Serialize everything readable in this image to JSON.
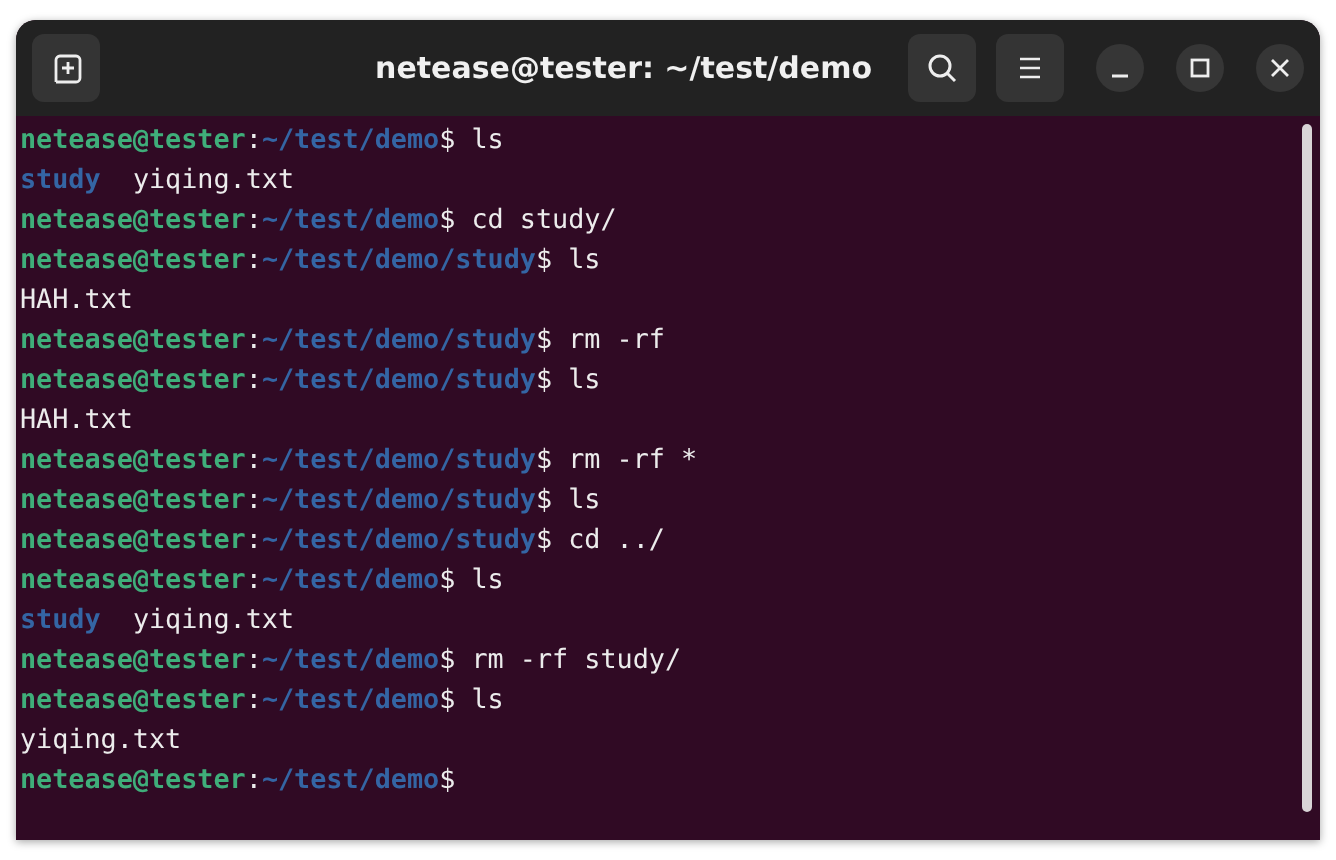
{
  "window": {
    "title": "netease@tester: ~/test/demo"
  },
  "terminal": {
    "lines": [
      {
        "kind": "prompt",
        "user": "netease@tester",
        "separator": ":",
        "path": "~/test/demo",
        "symbol": "$",
        "command": " ls"
      },
      {
        "kind": "output",
        "entries": [
          {
            "kind": "dir",
            "name": "study"
          },
          {
            "kind": "file",
            "name": "yiqing.txt"
          }
        ]
      },
      {
        "kind": "prompt",
        "user": "netease@tester",
        "separator": ":",
        "path": "~/test/demo",
        "symbol": "$",
        "command": " cd study/"
      },
      {
        "kind": "prompt",
        "user": "netease@tester",
        "separator": ":",
        "path": "~/test/demo/study",
        "symbol": "$",
        "command": " ls"
      },
      {
        "kind": "output",
        "entries": [
          {
            "kind": "file",
            "name": "HAH.txt"
          }
        ]
      },
      {
        "kind": "prompt",
        "user": "netease@tester",
        "separator": ":",
        "path": "~/test/demo/study",
        "symbol": "$",
        "command": " rm -rf"
      },
      {
        "kind": "prompt",
        "user": "netease@tester",
        "separator": ":",
        "path": "~/test/demo/study",
        "symbol": "$",
        "command": " ls"
      },
      {
        "kind": "output",
        "entries": [
          {
            "kind": "file",
            "name": "HAH.txt"
          }
        ]
      },
      {
        "kind": "prompt",
        "user": "netease@tester",
        "separator": ":",
        "path": "~/test/demo/study",
        "symbol": "$",
        "command": " rm -rf *"
      },
      {
        "kind": "prompt",
        "user": "netease@tester",
        "separator": ":",
        "path": "~/test/demo/study",
        "symbol": "$",
        "command": " ls"
      },
      {
        "kind": "prompt",
        "user": "netease@tester",
        "separator": ":",
        "path": "~/test/demo/study",
        "symbol": "$",
        "command": " cd ../"
      },
      {
        "kind": "prompt",
        "user": "netease@tester",
        "separator": ":",
        "path": "~/test/demo",
        "symbol": "$",
        "command": " ls"
      },
      {
        "kind": "output",
        "entries": [
          {
            "kind": "dir",
            "name": "study"
          },
          {
            "kind": "file",
            "name": "yiqing.txt"
          }
        ]
      },
      {
        "kind": "prompt",
        "user": "netease@tester",
        "separator": ":",
        "path": "~/test/demo",
        "symbol": "$",
        "command": " rm -rf study/"
      },
      {
        "kind": "prompt",
        "user": "netease@tester",
        "separator": ":",
        "path": "~/test/demo",
        "symbol": "$",
        "command": " ls"
      },
      {
        "kind": "output",
        "entries": [
          {
            "kind": "file",
            "name": "yiqing.txt"
          }
        ]
      },
      {
        "kind": "prompt",
        "user": "netease@tester",
        "separator": ":",
        "path": "~/test/demo",
        "symbol": "$"
      }
    ]
  }
}
